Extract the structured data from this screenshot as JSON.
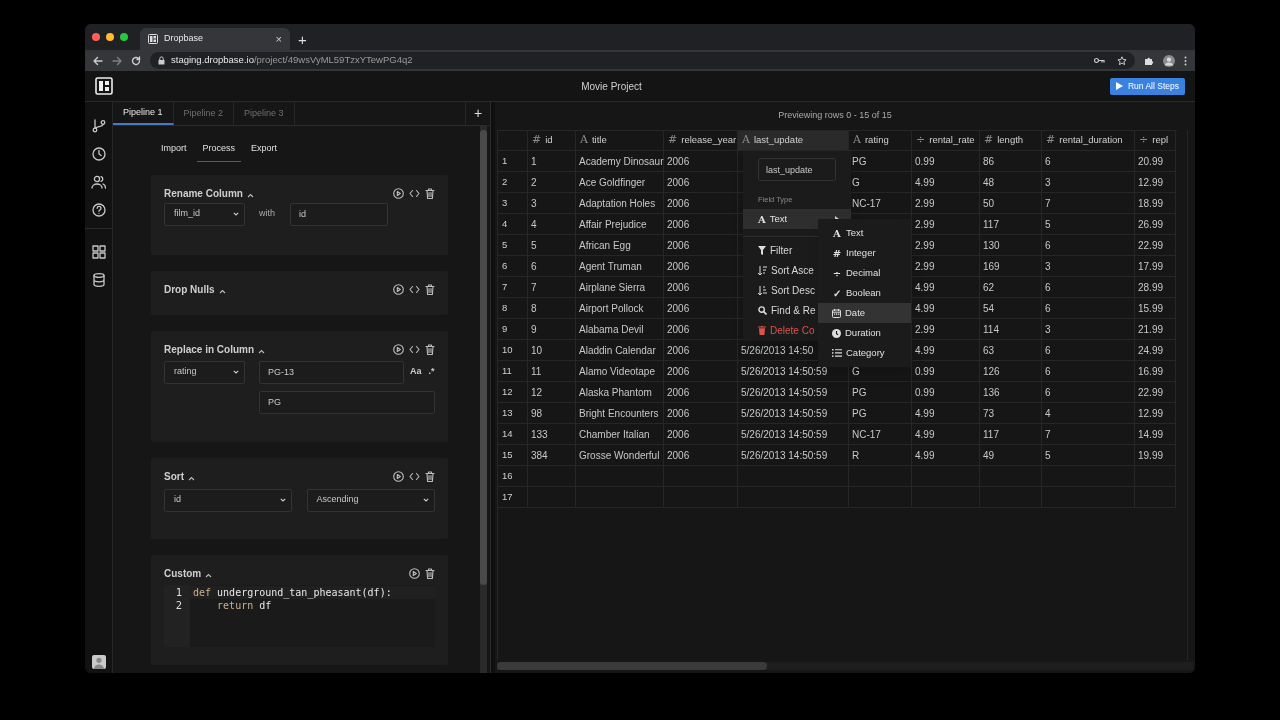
{
  "browser": {
    "tab_title": "Dropbase",
    "tab_close": "×",
    "new_tab": "+",
    "url_host": "staging.dropbase.io",
    "url_path": "/project/49wsVyML59TzxYTewPG4q2"
  },
  "app": {
    "title": "Movie Project",
    "run_button": "Run All Steps"
  },
  "pipeline_tabs": [
    {
      "label": "Pipeline 1",
      "selected": true
    },
    {
      "label": "Pipeline 2",
      "selected": false
    },
    {
      "label": "Pipeline 3",
      "selected": false
    }
  ],
  "add_pipeline": "+",
  "step_tabs": [
    {
      "label": "Import",
      "selected": false
    },
    {
      "label": "Process",
      "selected": true
    },
    {
      "label": "Export",
      "selected": false
    }
  ],
  "steps": [
    {
      "kind": "rename",
      "title": "Rename Column",
      "column": "film_id",
      "with_label": "with",
      "new_name": "id"
    },
    {
      "kind": "drop_nulls",
      "title": "Drop Nulls"
    },
    {
      "kind": "replace",
      "title": "Replace in Column",
      "column": "rating",
      "find": "PG-13",
      "replace": "PG",
      "case_toggle": "Aa",
      "regex_toggle": ".*"
    },
    {
      "kind": "sort",
      "title": "Sort",
      "column": "id",
      "order": "Ascending"
    },
    {
      "kind": "custom",
      "title": "Custom",
      "code": [
        {
          "number": "1",
          "tokens": [
            {
              "kind": "keyword",
              "text": "def"
            },
            {
              "kind": "plain",
              "text": " underground_tan_pheasant(df):"
            }
          ]
        },
        {
          "number": "2",
          "tokens": [
            {
              "kind": "keyword",
              "text": "    return"
            },
            {
              "kind": "plain",
              "text": " df"
            }
          ]
        }
      ]
    }
  ],
  "preview": {
    "caption": "Previewing rows 0 - 15 of 15",
    "columns": [
      {
        "glyph": "#",
        "name": "id",
        "selected": false
      },
      {
        "glyph": "A",
        "name": "title",
        "selected": false
      },
      {
        "glyph": "#",
        "name": "release_year",
        "selected": false
      },
      {
        "glyph": "A",
        "name": "last_update",
        "selected": true
      },
      {
        "glyph": "A",
        "name": "rating",
        "selected": false
      },
      {
        "glyph": "÷",
        "name": "rental_rate",
        "selected": false
      },
      {
        "glyph": "#",
        "name": "length",
        "selected": false
      },
      {
        "glyph": "#",
        "name": "rental_duration",
        "selected": false
      },
      {
        "glyph": "÷",
        "name": "repl",
        "selected": false
      }
    ],
    "rows": [
      {
        "number": "1",
        "cells": [
          "1",
          "Academy Dinosaur",
          "2006",
          null,
          "PG",
          "0.99",
          "86",
          "6",
          "20.99"
        ]
      },
      {
        "number": "2",
        "cells": [
          "2",
          "Ace Goldfinger",
          "2006",
          null,
          "G",
          "4.99",
          "48",
          "3",
          "12.99"
        ]
      },
      {
        "number": "3",
        "cells": [
          "3",
          "Adaptation Holes",
          "2006",
          null,
          "NC-17",
          "2.99",
          "50",
          "7",
          "18.99"
        ]
      },
      {
        "number": "4",
        "cells": [
          "4",
          "Affair Prejudice",
          "2006",
          null,
          null,
          "2.99",
          "117",
          "5",
          "26.99"
        ]
      },
      {
        "number": "5",
        "cells": [
          "5",
          "African Egg",
          "2006",
          null,
          null,
          "2.99",
          "130",
          "6",
          "22.99"
        ]
      },
      {
        "number": "6",
        "cells": [
          "6",
          "Agent Truman",
          "2006",
          null,
          null,
          "2.99",
          "169",
          "3",
          "17.99"
        ]
      },
      {
        "number": "7",
        "cells": [
          "7",
          "Airplane Sierra",
          "2006",
          null,
          null,
          "4.99",
          "62",
          "6",
          "28.99"
        ]
      },
      {
        "number": "8",
        "cells": [
          "8",
          "Airport Pollock",
          "2006",
          null,
          null,
          "4.99",
          "54",
          "6",
          "15.99"
        ]
      },
      {
        "number": "9",
        "cells": [
          "9",
          "Alabama Devil",
          "2006",
          null,
          null,
          "2.99",
          "114",
          "3",
          "21.99"
        ]
      },
      {
        "number": "10",
        "cells": [
          "10",
          "Aladdin Calendar",
          "2006",
          "5/26/2013 14:50",
          null,
          "4.99",
          "63",
          "6",
          "24.99"
        ]
      },
      {
        "number": "11",
        "cells": [
          "11",
          "Alamo Videotape",
          "2006",
          "5/26/2013 14:50:59",
          "G",
          "0.99",
          "126",
          "6",
          "16.99"
        ]
      },
      {
        "number": "12",
        "cells": [
          "12",
          "Alaska Phantom",
          "2006",
          "5/26/2013 14:50:59",
          "PG",
          "0.99",
          "136",
          "6",
          "22.99"
        ]
      },
      {
        "number": "13",
        "cells": [
          "98",
          "Bright Encounters",
          "2006",
          "5/26/2013 14:50:59",
          "PG",
          "4.99",
          "73",
          "4",
          "12.99"
        ]
      },
      {
        "number": "14",
        "cells": [
          "133",
          "Chamber Italian",
          "2006",
          "5/26/2013 14:50:59",
          "NC-17",
          "4.99",
          "117",
          "7",
          "14.99"
        ]
      },
      {
        "number": "15",
        "cells": [
          "384",
          "Grosse Wonderful",
          "2006",
          "5/26/2013 14:50:59",
          "R",
          "4.99",
          "49",
          "5",
          "19.99"
        ]
      },
      {
        "number": "16",
        "cells": [
          null,
          null,
          null,
          null,
          null,
          null,
          null,
          null,
          null
        ]
      },
      {
        "number": "17",
        "cells": [
          null,
          null,
          null,
          null,
          null,
          null,
          null,
          null,
          null
        ]
      }
    ]
  },
  "column_menu": {
    "name_field": "last_update",
    "section_label": "Field Type",
    "current_type": {
      "glyph": "A",
      "label": "Text"
    },
    "actions": [
      {
        "kind": "filter",
        "label": "Filter"
      },
      {
        "kind": "sort_asc",
        "label": "Sort Asce"
      },
      {
        "kind": "sort_desc",
        "label": "Sort Desc"
      },
      {
        "kind": "find",
        "label": "Find & Re"
      },
      {
        "kind": "delete",
        "label": "Delete Co"
      }
    ]
  },
  "type_menu": [
    {
      "kind": "glyph",
      "glyph": "A",
      "label": "Text",
      "selected": false
    },
    {
      "kind": "glyph",
      "glyph": "#",
      "label": "Integer",
      "selected": false
    },
    {
      "kind": "glyph",
      "glyph": "÷",
      "label": "Decimal",
      "selected": false
    },
    {
      "kind": "glyph",
      "glyph": "✓",
      "label": "Boolean",
      "selected": false
    },
    {
      "kind": "date",
      "label": "Date",
      "selected": true
    },
    {
      "kind": "duration",
      "label": "Duration",
      "selected": false
    },
    {
      "kind": "category",
      "label": "Category",
      "selected": false
    }
  ]
}
